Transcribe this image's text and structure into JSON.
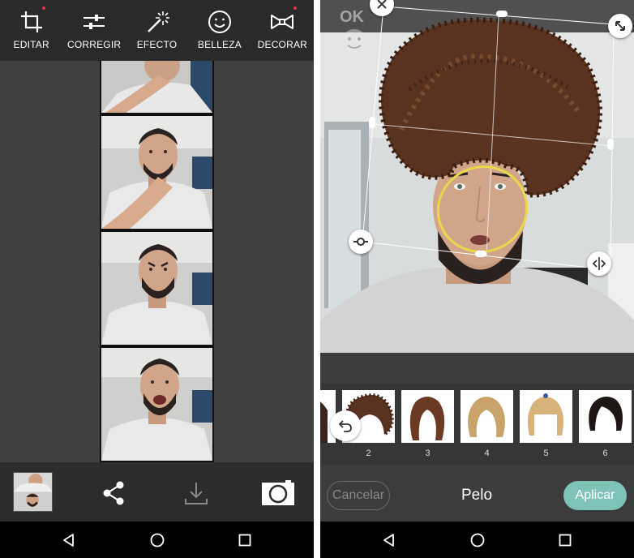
{
  "left_screen": {
    "toolbar": [
      {
        "label": "EDITAR",
        "icon": "crop-icon",
        "badge": true
      },
      {
        "label": "CORREGIR",
        "icon": "sliders-icon",
        "badge": false
      },
      {
        "label": "EFECTO",
        "icon": "magic-wand-icon",
        "badge": false
      },
      {
        "label": "BELLEZA",
        "icon": "smiley-icon",
        "badge": false
      },
      {
        "label": "DECORAR",
        "icon": "bow-tie-icon",
        "badge": true
      }
    ],
    "photo_strip": {
      "frames": 4
    },
    "bottom_bar": [
      "thumbnail",
      "share-icon",
      "download-icon",
      "camera-icon"
    ]
  },
  "right_screen": {
    "overlay": {
      "ok_label": "OK"
    },
    "hair_styles": [
      {
        "number": "2",
        "style": "afro"
      },
      {
        "number": "3",
        "style": "long-brown"
      },
      {
        "number": "4",
        "style": "long-blonde"
      },
      {
        "number": "5",
        "style": "blonde-bangs"
      },
      {
        "number": "6",
        "style": "black-bob"
      }
    ],
    "actions": {
      "cancel": "Cancelar",
      "title": "Pelo",
      "apply": "Aplicar"
    }
  },
  "navigation": [
    "back-icon",
    "home-icon",
    "recents-icon"
  ],
  "colors": {
    "accent": "#7fc3b8",
    "badge": "#e2334a",
    "face_outline": "#e8d84a"
  }
}
